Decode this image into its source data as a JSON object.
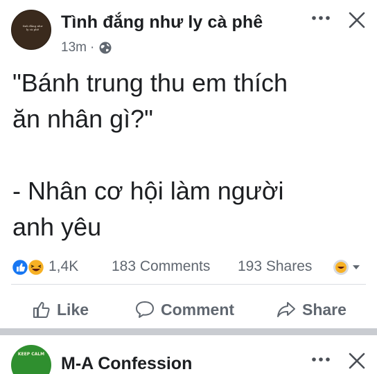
{
  "post1": {
    "avatar_text": "tình đắng như ly cà phê",
    "page_name": "Tình đắng như ly cà phê",
    "time": "13m",
    "separator_dot": "·",
    "privacy_icon": "globe-icon",
    "more_icon": "more-dots-icon",
    "close_icon": "close-icon",
    "text": "\"Bánh trung thu em thích\năn nhân gì?\"\n\n- Nhân cơ hội làm người\nanh yêu",
    "reactions": {
      "icons": [
        "like-reaction-icon",
        "haha-reaction-icon"
      ],
      "count": "1,4K",
      "comments": "183 Comments",
      "shares": "193 Shares"
    },
    "actions": {
      "like": "Like",
      "comment": "Comment",
      "share": "Share"
    }
  },
  "post2": {
    "avatar_text": "KEEP CALM",
    "page_name": "M-A Confession",
    "more_icon": "more-dots-icon",
    "close_icon": "close-icon"
  },
  "colors": {
    "text_primary": "#1c1e21",
    "text_secondary": "#606770",
    "like_blue": "#1877f2",
    "haha_yellow": "#f7b125",
    "separator": "#c9ccd1"
  }
}
